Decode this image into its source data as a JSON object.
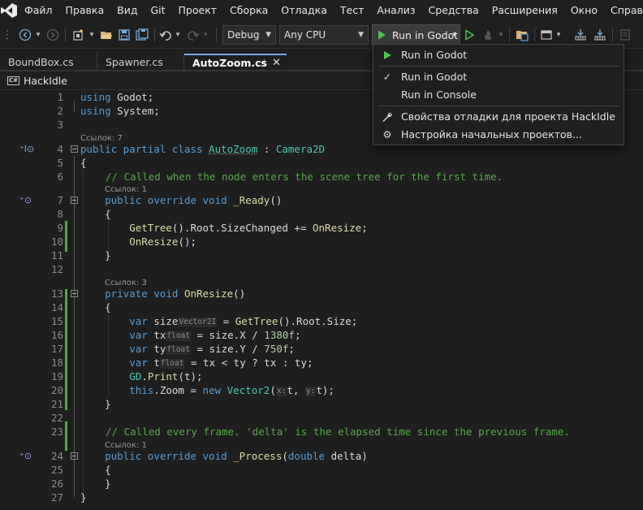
{
  "menu": {
    "items": [
      "Файл",
      "Правка",
      "Вид",
      "Git",
      "Проект",
      "Сборка",
      "Отладка",
      "Тест",
      "Анализ",
      "Средства",
      "Расширения",
      "Окно",
      "Справка"
    ]
  },
  "toolbar": {
    "configuration": "Debug",
    "platform": "Any CPU",
    "run_label": "Run in Godot"
  },
  "tabs": [
    {
      "label": "BoundBox.cs",
      "active": false
    },
    {
      "label": "Spawner.cs",
      "active": false
    },
    {
      "label": "AutoZoom.cs",
      "active": true
    }
  ],
  "project": {
    "badge": "C#",
    "name": "HackIdle"
  },
  "editor": {
    "line_numbers": [
      "1",
      "2",
      "3",
      "4",
      "5",
      "6",
      "7",
      "8",
      "9",
      "10",
      "11",
      "12",
      "13",
      "14",
      "15",
      "16",
      "17",
      "18",
      "19",
      "20",
      "21",
      "22",
      "23",
      "24",
      "25",
      "26",
      "27"
    ],
    "references": {
      "class": "Ссылок: 7",
      "ready": "Ссылок: 1",
      "onresize": "Ссылок: 3",
      "process": "Ссылок: 1"
    },
    "inlay_hints": {
      "size": "Vector2I",
      "tx": "float",
      "ty": "float",
      "t": "float",
      "x": "x:",
      "y": "y:"
    },
    "comments": {
      "c1": "// Called when the node enters the scene tree for the first time.",
      "c2": "// Called every frame. 'delta' is the elapsed time since the previous frame."
    }
  },
  "dropdown": {
    "items": [
      {
        "label": "Run in Godot",
        "icon": "play-icon"
      },
      {
        "label": "Run in Godot",
        "icon": "check-icon"
      },
      {
        "label": "Run in Console",
        "icon": ""
      },
      {
        "label": "Свойства отладки для проекта HackIdle",
        "icon": "wrench-icon"
      },
      {
        "label": "Настройка начальных проектов...",
        "icon": "gear-icon"
      }
    ]
  },
  "colors": {
    "keyword": "#569cd6",
    "type": "#4ec9b0",
    "method": "#dcdcaa",
    "comment": "#57a64a",
    "number": "#b5cea8",
    "run_green": "#4ec94e"
  }
}
